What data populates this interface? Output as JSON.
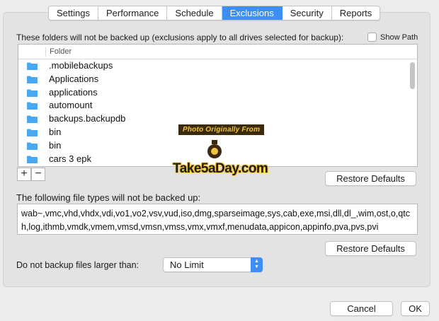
{
  "tabs": [
    {
      "label": "Settings",
      "active": false
    },
    {
      "label": "Performance",
      "active": false
    },
    {
      "label": "Schedule",
      "active": false
    },
    {
      "label": "Exclusions",
      "active": true
    },
    {
      "label": "Security",
      "active": false
    },
    {
      "label": "Reports",
      "active": false
    }
  ],
  "folders_section": {
    "description": "These folders will not be backed up (exclusions apply to all drives selected for backup):",
    "show_path_label": "Show Path",
    "show_path_checked": false,
    "column_header": "Folder",
    "items": [
      ".mobilebackups",
      "Applications",
      "applications",
      "automount",
      "backups.backupdb",
      "bin",
      "bin",
      "cars 3 epk"
    ],
    "add_label": "+",
    "remove_label": "−",
    "restore_label": "Restore Defaults"
  },
  "filetypes_section": {
    "description": "The following file types will not be backed up:",
    "value": "wab~,vmc,vhd,vhdx,vdi,vo1,vo2,vsv,vud,iso,dmg,sparseimage,sys,cab,exe,msi,dll,dl_,wim,ost,o,qtch,log,ithmb,vmdk,vmem,vmsd,vmsn,vmss,vmx,vmxf,menudata,appicon,appinfo,pva,pvs,pvi",
    "restore_label": "Restore Defaults"
  },
  "size_limit": {
    "label": "Do not backup files larger than:",
    "selected": "No Limit"
  },
  "footer": {
    "cancel_label": "Cancel",
    "ok_label": "OK"
  },
  "watermark": {
    "top_text": "Photo Originally From",
    "logo_text": "Take5aDay.com"
  },
  "colors": {
    "accent": "#3d8ef7",
    "folder_icon": "#4aa8f0",
    "window_bg": "#ececec",
    "panel_bg": "#e3e3e3"
  }
}
